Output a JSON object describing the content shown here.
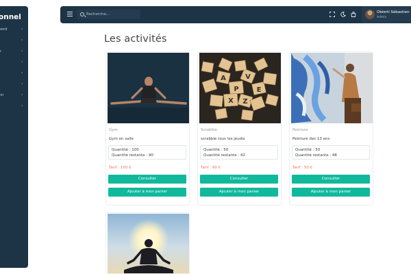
{
  "app": {
    "sidebar_title": "onnel",
    "sidebar_items": [
      {
        "label": "bord"
      },
      {
        "label": ""
      },
      {
        "label": "s"
      },
      {
        "label": ""
      },
      {
        "label": ""
      },
      {
        "label": ""
      },
      {
        "label": "nn"
      },
      {
        "label": ""
      }
    ]
  },
  "topbar": {
    "search_placeholder": "Recherche...",
    "user_name": "Obiertí Sébastien",
    "user_role": "Admin",
    "icons": [
      "hamburger-icon",
      "search-icon",
      "fullscreen-icon",
      "moon-icon",
      "shopping-bag-icon"
    ]
  },
  "page": {
    "title": "Les activités"
  },
  "activities": [
    {
      "name": "Gym",
      "description": "Gym en salle",
      "quantity": "Quantité : 100",
      "remaining": "Quantité restante : 90",
      "price": "Tarif : 150 €",
      "consult_label": "Consulter",
      "cart_label": "Ajouter à mon panier"
    },
    {
      "name": "Scrabble",
      "description": "scrabble tous les jeudis",
      "quantity": "Quantité : 50",
      "remaining": "Quantité restante : 42",
      "price": "Tarif : 90 €",
      "consult_label": "Consulter",
      "cart_label": "Ajouter à mon panier"
    },
    {
      "name": "Peinture",
      "description": "Peinture des 13 ans",
      "quantity": "Quantité : 50",
      "remaining": "Quantité restante : 48",
      "price": "Tarif : 50 €",
      "consult_label": "Consulter",
      "cart_label": "Ajouter à mon panier"
    }
  ],
  "colors": {
    "sidebar_bg": "#1d3346",
    "button": "#10b99c",
    "price": "#f07255"
  }
}
